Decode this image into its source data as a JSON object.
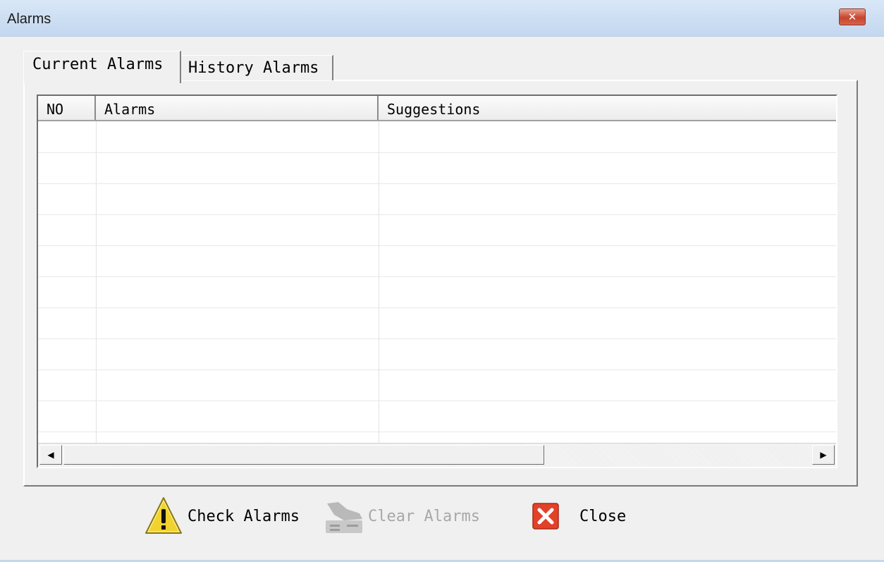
{
  "window": {
    "title": "Alarms",
    "close_glyph": "✕"
  },
  "tabs": [
    {
      "label": "Current Alarms",
      "active": true
    },
    {
      "label": "History Alarms",
      "active": false
    }
  ],
  "grid": {
    "columns": [
      "NO",
      "Alarms",
      "Suggestions"
    ],
    "rows": []
  },
  "scrollbar": {
    "left_arrow": "◀",
    "right_arrow": "▶"
  },
  "buttons": {
    "check": {
      "label": "Check Alarms",
      "icon": "warning-icon",
      "enabled": true
    },
    "clear": {
      "label": "Clear Alarms",
      "icon": "clear-broom-icon",
      "enabled": false
    },
    "close": {
      "label": "Close",
      "icon": "close-x-icon",
      "enabled": true
    }
  },
  "colors": {
    "warning_yellow": "#f2d22e",
    "close_red": "#e2412a",
    "disabled_text": "#a8a8a8"
  }
}
